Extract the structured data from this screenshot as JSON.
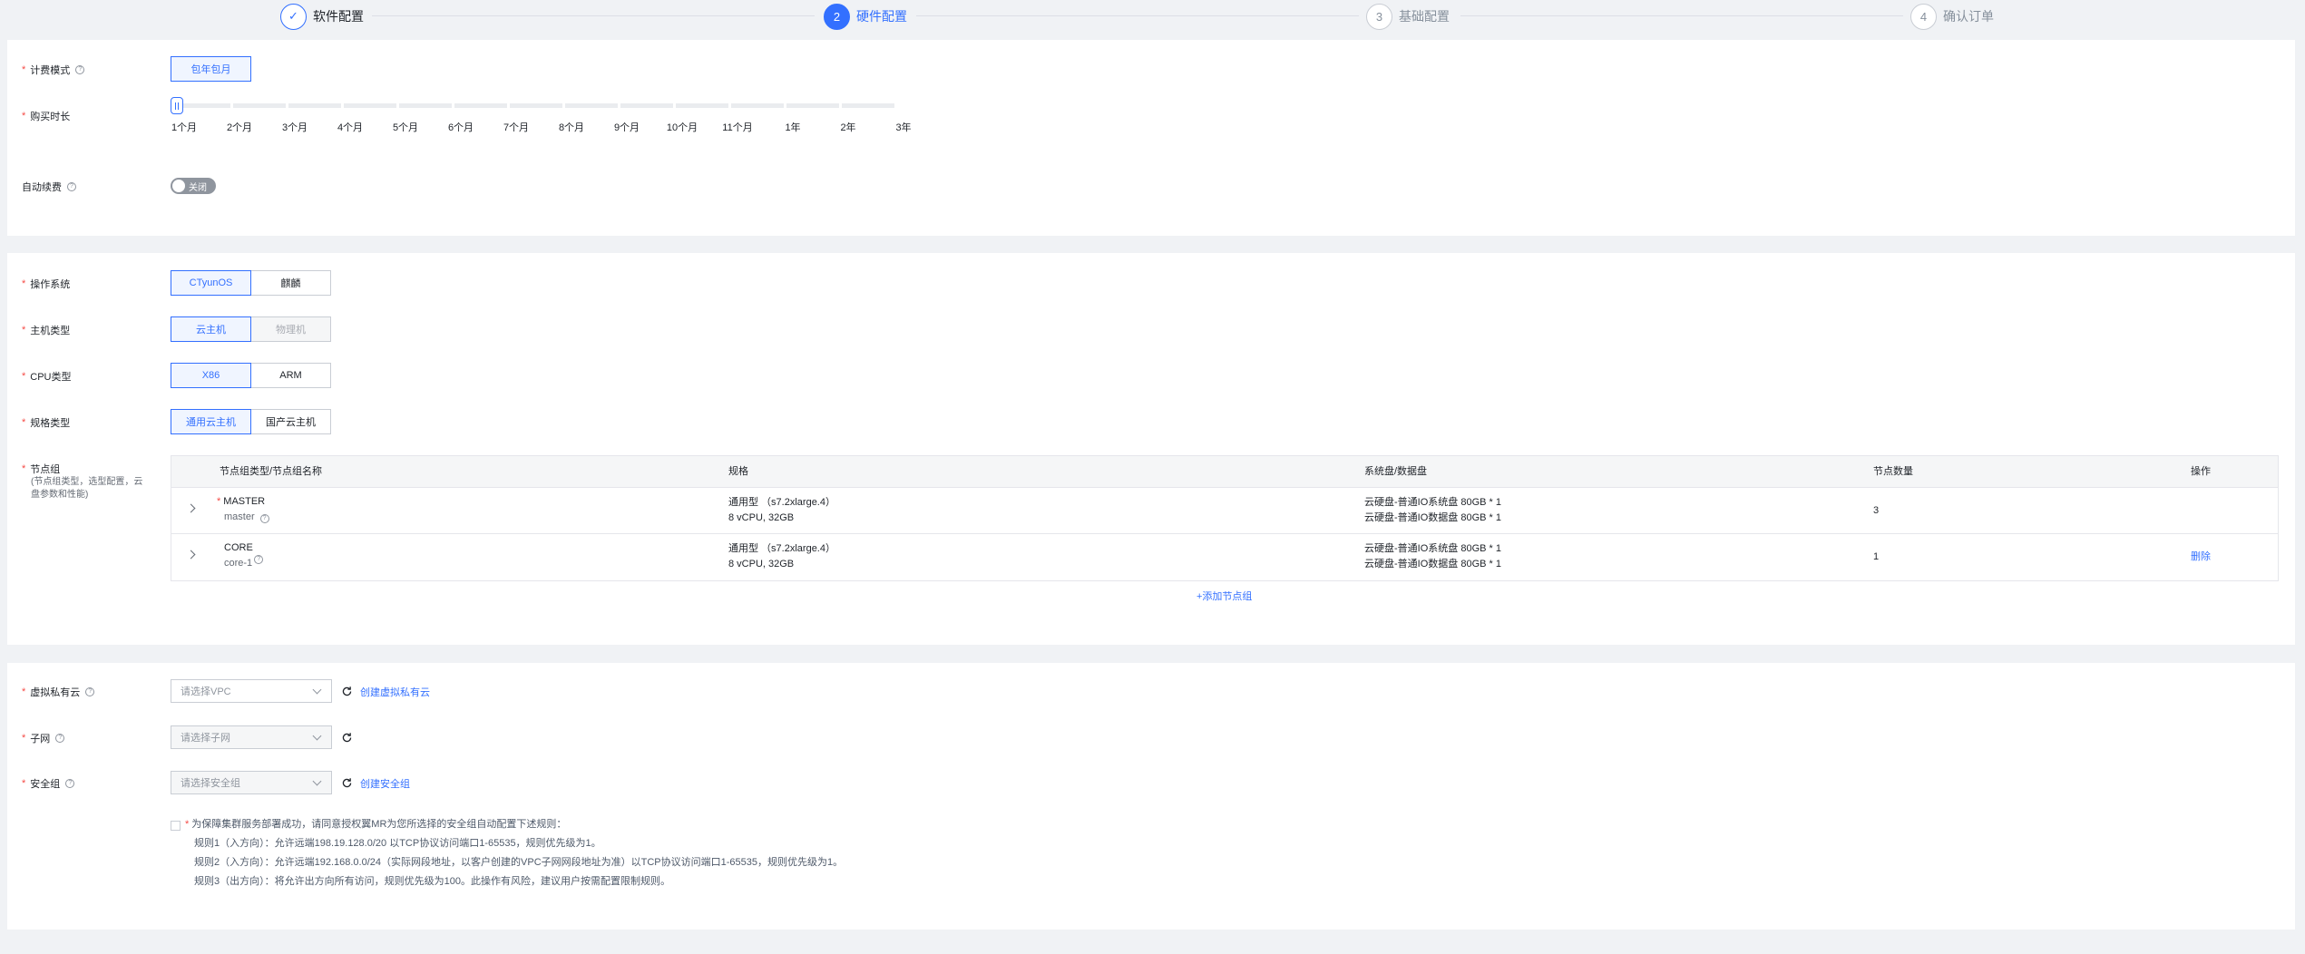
{
  "steps": [
    {
      "num": "✓",
      "label": "软件配置",
      "state": "done"
    },
    {
      "num": "2",
      "label": "硬件配置",
      "state": "active"
    },
    {
      "num": "3",
      "label": "基础配置",
      "state": "pending"
    },
    {
      "num": "4",
      "label": "确认订单",
      "state": "pending"
    }
  ],
  "billing": {
    "mode_label": "计费模式",
    "mode_value": "包年包月",
    "duration_label": "购买时长",
    "duration_ticks": [
      "1个月",
      "2个月",
      "3个月",
      "4个月",
      "5个月",
      "6个月",
      "7个月",
      "8个月",
      "9个月",
      "10个月",
      "11个月",
      "1年",
      "2年",
      "3年"
    ],
    "duration_selected": "1个月",
    "autorenew_label": "自动续费",
    "autorenew_state": "关闭"
  },
  "hardware": {
    "os_label": "操作系统",
    "os_options": [
      "CTyunOS",
      "麒麟"
    ],
    "host_label": "主机类型",
    "host_options": [
      "云主机",
      "物理机"
    ],
    "cpu_label": "CPU类型",
    "cpu_options": [
      "X86",
      "ARM"
    ],
    "spec_label": "规格类型",
    "spec_options": [
      "通用云主机",
      "国产云主机"
    ],
    "node_label": "节点组",
    "node_hint_1": "(节点组类型，选型配置，云",
    "node_hint_2": "盘参数和性能)",
    "table": {
      "headers": [
        "节点组类型/节点组名称",
        "规格",
        "系统盘/数据盘",
        "节点数量",
        "操作"
      ],
      "rows": [
        {
          "type": "MASTER",
          "name": "master",
          "required": true,
          "spec1": "通用型 （s7.2xlarge.4）",
          "spec2": "8 vCPU, 32GB",
          "disk1": "云硬盘-普通IO系统盘 80GB * 1",
          "disk2": "云硬盘-普通IO数据盘 80GB * 1",
          "count": "3",
          "action": ""
        },
        {
          "type": "CORE",
          "name": "core-1",
          "required": false,
          "spec1": "通用型 （s7.2xlarge.4）",
          "spec2": "8 vCPU, 32GB",
          "disk1": "云硬盘-普通IO系统盘 80GB * 1",
          "disk2": "云硬盘-普通IO数据盘 80GB * 1",
          "count": "1",
          "action": "删除"
        }
      ]
    },
    "add_node_group": "+添加节点组"
  },
  "network": {
    "vpc_label": "虚拟私有云",
    "vpc_placeholder": "请选择VPC",
    "vpc_create": "创建虚拟私有云",
    "subnet_label": "子网",
    "subnet_placeholder": "请选择子网",
    "sg_label": "安全组",
    "sg_placeholder": "请选择安全组",
    "sg_create": "创建安全组",
    "agree_text": "为保障集群服务部署成功，请同意授权翼MR为您所选择的安全组自动配置下述规则：",
    "rule1": "规则1（入方向）：允许远端198.19.128.0/20 以TCP协议访问端口1-65535，规则优先级为1。",
    "rule2": "规则2（入方向）：允许远端192.168.0.0/24（实际网段地址，以客户创建的VPC子网网段地址为准）以TCP协议访问端口1-65535，规则优先级为1。",
    "rule3": "规则3（出方向）：将允许出方向所有访问，规则优先级为100。此操作有风险，建议用户按需配置限制规则。"
  }
}
